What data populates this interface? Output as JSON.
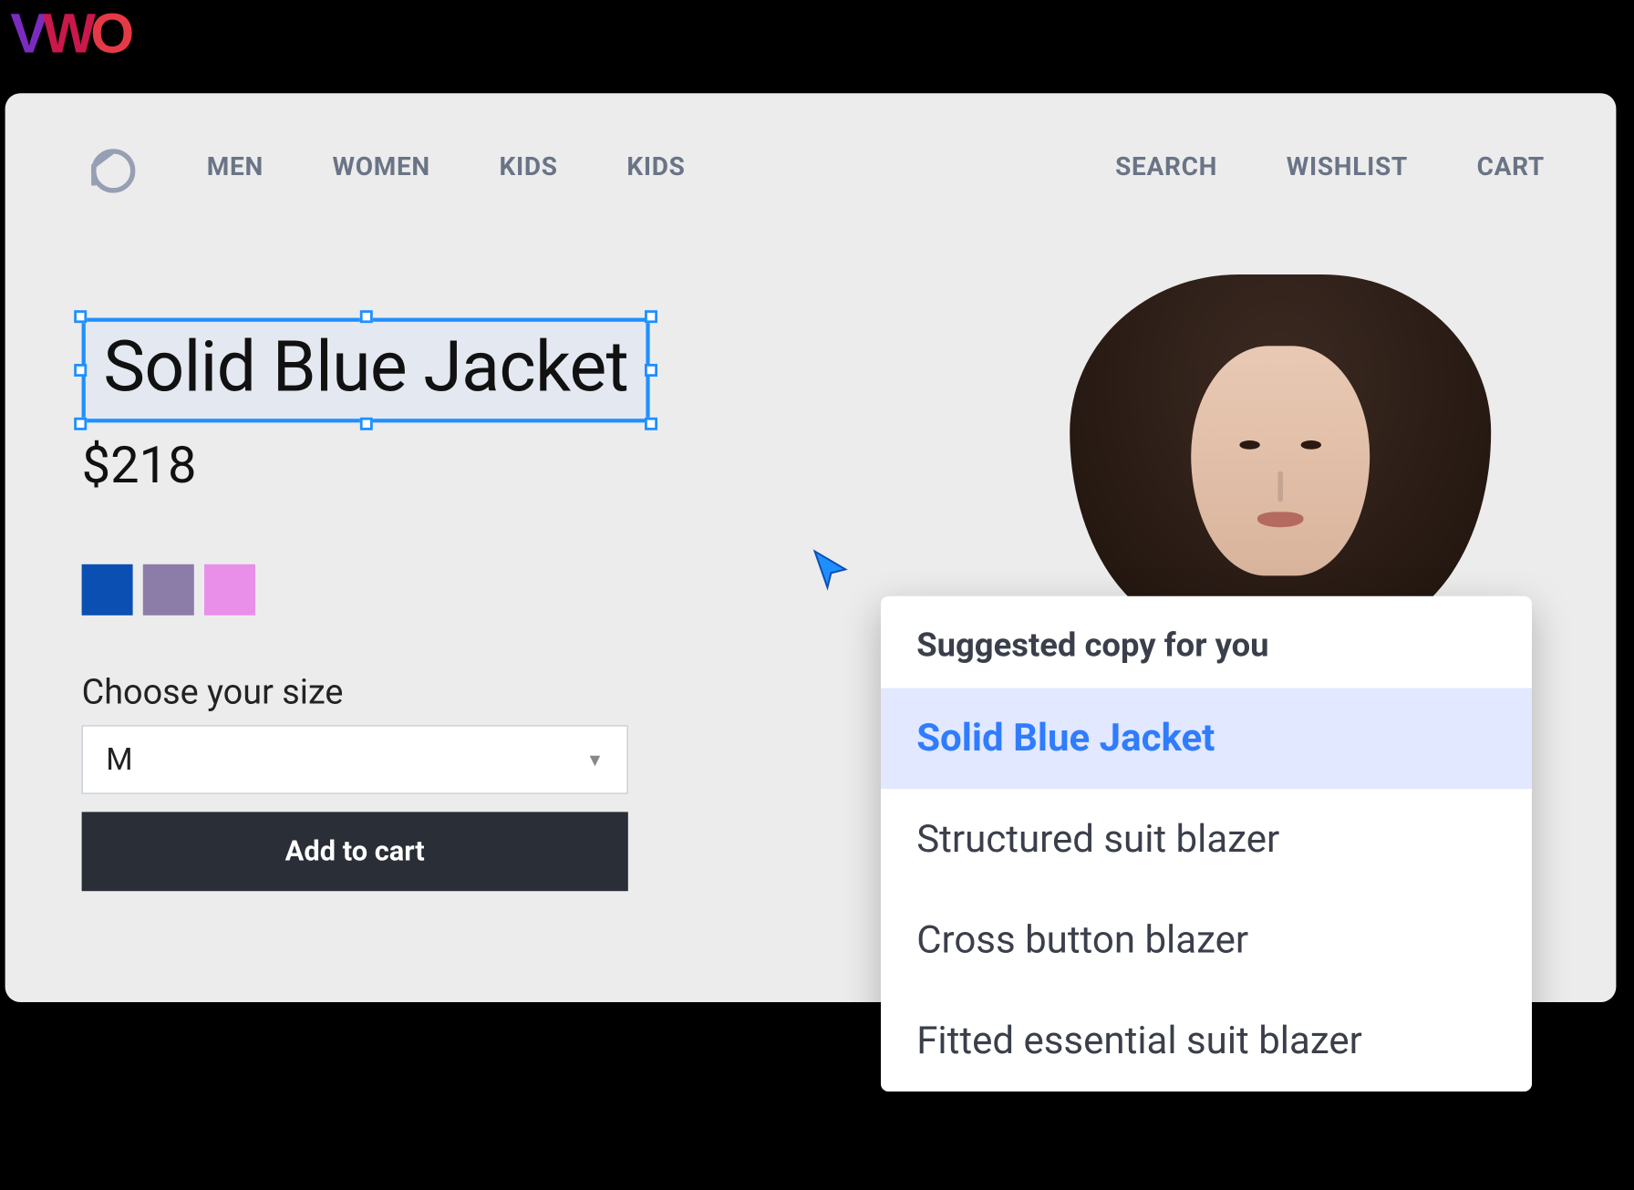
{
  "brand_overlay": {
    "v": "V",
    "w": "W",
    "o": "O"
  },
  "nav": {
    "left": [
      "MEN",
      "WOMEN",
      "KIDS",
      "KIDS"
    ],
    "right": [
      "SEARCH",
      "WISHLIST",
      "CART"
    ]
  },
  "product": {
    "title": "Solid Blue Jacket",
    "price": "$218",
    "size_label": "Choose your size",
    "selected_size": "M",
    "add_to_cart": "Add to cart",
    "swatches": [
      "#0B4FB3",
      "#8C7CA8",
      "#E98FE9"
    ]
  },
  "suggestions": {
    "header": "Suggested copy for you",
    "items": [
      {
        "label": "Solid Blue Jacket",
        "active": true
      },
      {
        "label": "Structured suit blazer",
        "active": false
      },
      {
        "label": "Cross button blazer",
        "active": false
      },
      {
        "label": "Fitted essential suit blazer",
        "active": false
      }
    ]
  }
}
